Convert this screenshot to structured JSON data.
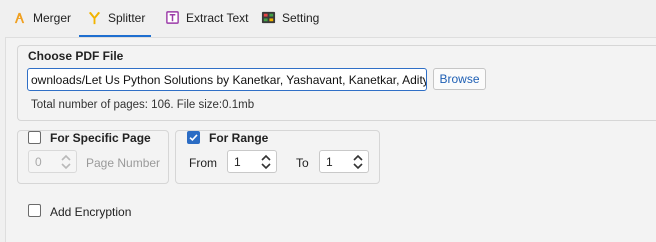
{
  "tabs": [
    {
      "label": "Merger",
      "icon": "merge-icon",
      "active": false
    },
    {
      "label": "Splitter",
      "icon": "split-icon",
      "active": true
    },
    {
      "label": "Extract Text",
      "icon": "extract-text-icon",
      "active": false
    },
    {
      "label": "Setting",
      "icon": "settings-panel-icon",
      "active": false
    }
  ],
  "choose_file": {
    "title": "Choose PDF File",
    "path_value": "ownloads/Let Us Python Solutions by Kanetkar, Yashavant, Kanetkar, Aditya.pdf",
    "browse_label": "Browse",
    "info": "Total number of pages: 106. File size:0.1mb"
  },
  "specific_page": {
    "label": "For Specific Page",
    "checked": false,
    "value": "0",
    "field_label": "Page Number"
  },
  "range": {
    "label": "For Range",
    "checked": true,
    "from_label": "From",
    "from_value": "1",
    "to_label": "To",
    "to_value": "1"
  },
  "encryption": {
    "label": "Add Encryption",
    "checked": false
  },
  "colors": {
    "accent": "#1e6fd0",
    "checkbox_checked": "#2b6cc4",
    "merger_icon": "#f0a020",
    "splitter_icon": "#f2b400",
    "extract_icon": "#9b3aa8"
  }
}
